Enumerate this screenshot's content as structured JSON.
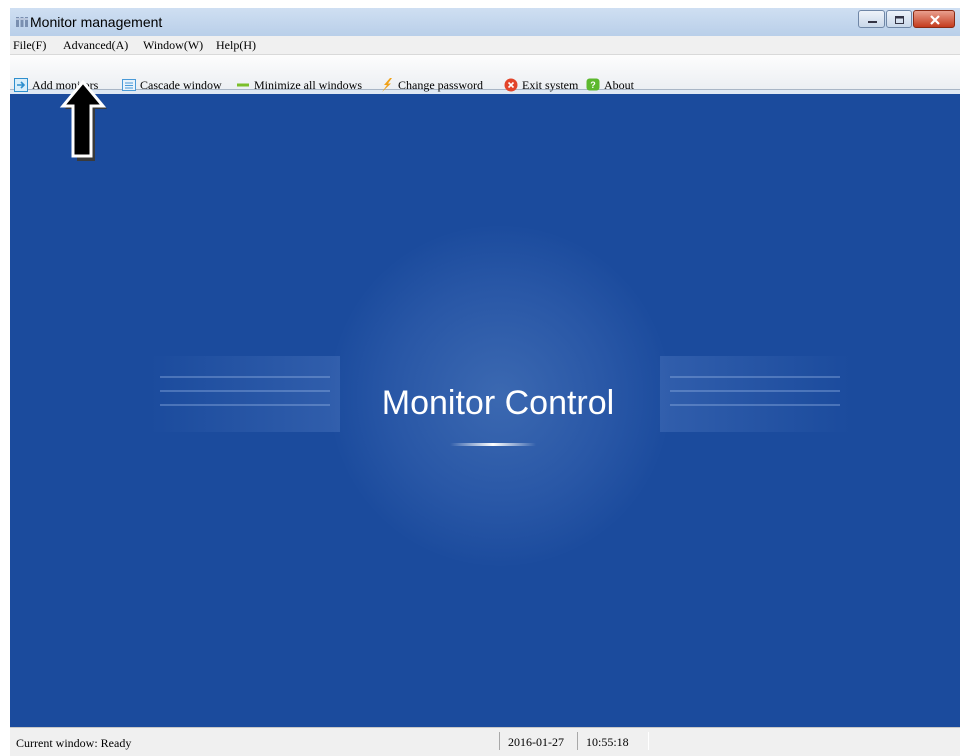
{
  "window": {
    "title": "Monitor management",
    "controls": [
      "minimize-icon",
      "maximize-icon",
      "close-icon"
    ]
  },
  "menu": {
    "items": [
      "File(F)",
      "Advanced(A)",
      "Window(W)",
      "Help(H)"
    ]
  },
  "toolbar": {
    "items": [
      {
        "label": "Add monitors",
        "icon": "add-monitor-icon",
        "color": "#2f8fce"
      },
      {
        "label": "Cascade window",
        "icon": "cascade-icon",
        "color": "#4a9ad8"
      },
      {
        "label": "Minimize all windows",
        "icon": "minimize-bar-icon",
        "color": "#7bbf2a"
      },
      {
        "label": "Change password",
        "icon": "lightning-icon",
        "color": "#f0a21a"
      },
      {
        "label": "Exit system",
        "icon": "exit-icon",
        "color": "#e2442a"
      },
      {
        "label": "About",
        "icon": "help-icon",
        "color": "#5cb82e"
      }
    ]
  },
  "main": {
    "hero_title": "Monitor Control",
    "background_color": "#1b4b9d"
  },
  "status": {
    "current_window": "Current window: Ready",
    "date": "2016-01-27",
    "time": "10:55:18"
  },
  "annotation": {
    "icon": "up-arrow-icon"
  }
}
